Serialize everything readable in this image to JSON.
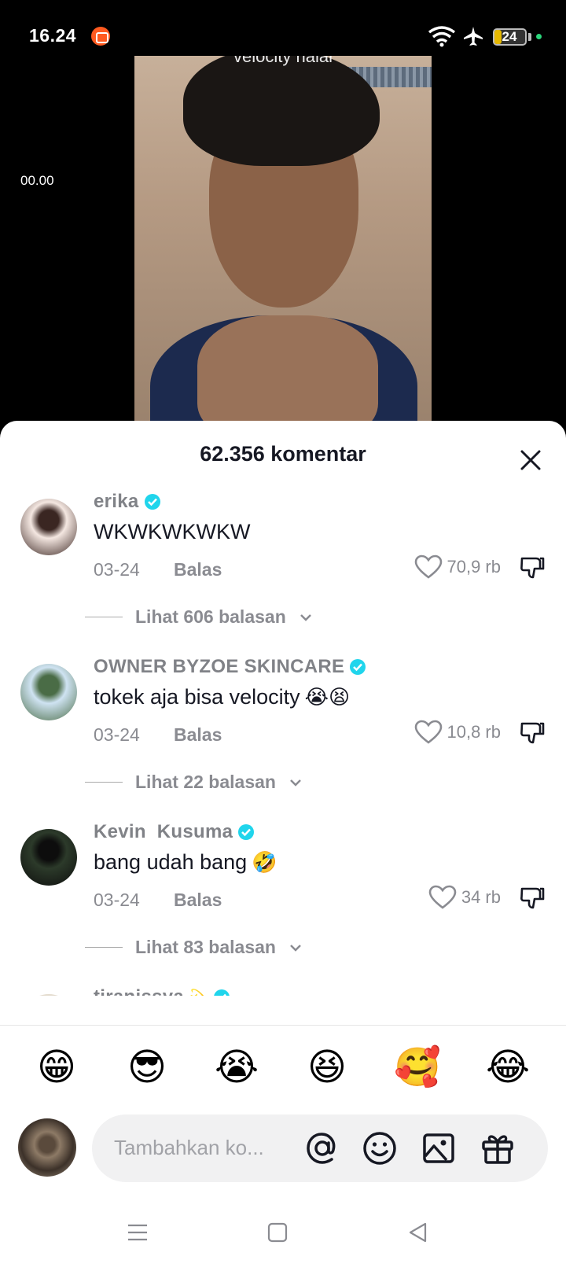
{
  "status_bar": {
    "time": "16.24",
    "battery": "24",
    "battery_level": 0.24,
    "icons": [
      "screen-record-icon",
      "wifi-icon",
      "airplane-mode-icon",
      "battery-icon"
    ]
  },
  "video": {
    "time": "00.00",
    "caption": "velocity halal"
  },
  "sheet": {
    "title": "62.356 komentar"
  },
  "comments": [
    {
      "username": "erika",
      "text": "WKWKWKWKW",
      "emoji": "",
      "date": "03-24",
      "reply_label": "Balas",
      "likes": "70,9 rb",
      "replies_label": "Lihat 606 balasan",
      "avatar_colors": [
        "#f4e7e1",
        "#3a2622"
      ]
    },
    {
      "username": "OWNER BYZOE SKINCARE",
      "text": "tokek aja bisa velocity",
      "emoji": "😭😫",
      "date": "03-24",
      "reply_label": "Balas",
      "likes": "10,8 rb",
      "replies_label": "Lihat 22 balasan",
      "avatar_colors": [
        "#cfe3f2",
        "#4a6c46"
      ]
    },
    {
      "username": "Kevin  Kusuma",
      "text": "bang udah bang",
      "emoji": "🤣",
      "date": "03-24",
      "reply_label": "Balas",
      "likes": "34 rb",
      "replies_label": "Lihat 83 balasan",
      "avatar_colors": [
        "#2c3a2a",
        "#0d0d0d"
      ]
    },
    {
      "username": "tiranissya",
      "text": "",
      "emoji": "💫",
      "date": "",
      "reply_label": "",
      "likes": "",
      "replies_label": "",
      "avatar_colors": [
        "#e9e2d6",
        "#b7a58f"
      ]
    }
  ],
  "emoji_bar": [
    "😁",
    "😎",
    "😭",
    "😆",
    "🥰",
    "😂"
  ],
  "composer": {
    "placeholder": "Tambahkan ko...",
    "icons": [
      "mention-icon",
      "emoji-icon",
      "image-icon",
      "gift-icon"
    ]
  },
  "nav": {
    "icons": [
      "recents-icon",
      "home-icon",
      "back-icon"
    ]
  },
  "colors": {
    "verified": "#20d5ec",
    "text_primary": "#161823",
    "text_secondary": "#8a8b91"
  }
}
